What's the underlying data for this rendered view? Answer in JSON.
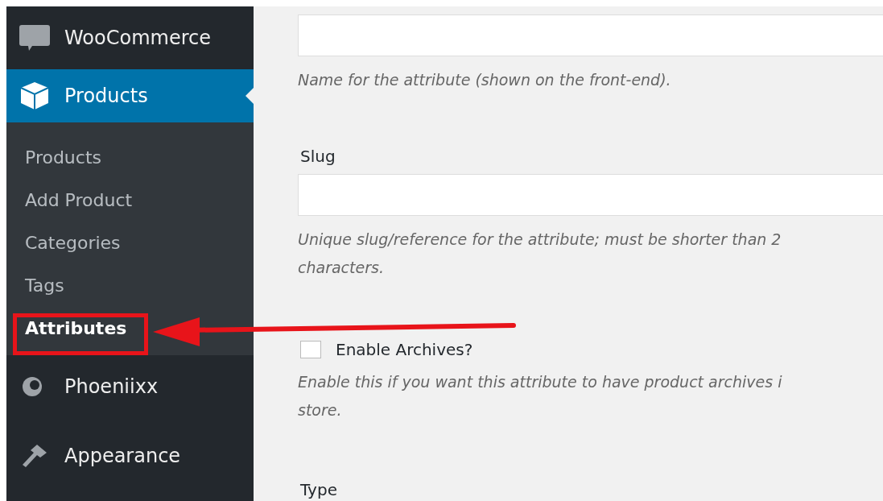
{
  "sidebar": {
    "items": [
      {
        "kind": "woo",
        "label": "WooCommerce",
        "selected": false
      },
      {
        "kind": "box",
        "label": "Products",
        "selected": true,
        "children": [
          {
            "label": "Products",
            "selected": false
          },
          {
            "label": "Add Product",
            "selected": false
          },
          {
            "label": "Categories",
            "selected": false
          },
          {
            "label": "Tags",
            "selected": false
          },
          {
            "label": "Attributes",
            "selected": true
          }
        ]
      },
      {
        "kind": "swirl",
        "label": "Phoeniixx",
        "selected": false
      },
      {
        "kind": "brush",
        "label": "Appearance",
        "selected": false
      }
    ]
  },
  "form": {
    "fields": [
      {
        "kind": "text",
        "description": [
          "Name for the attribute (shown on the front-end)."
        ]
      },
      {
        "kind": "text",
        "label": "Slug",
        "description": [
          "Unique slug/reference for the attribute; must be shorter than 2",
          "characters."
        ]
      },
      {
        "kind": "checkbox",
        "label": "Enable Archives?",
        "checked": false,
        "description": [
          "Enable this if you want this attribute to have product archives i",
          "store."
        ]
      },
      {
        "kind": "label",
        "label": "Type"
      }
    ]
  }
}
